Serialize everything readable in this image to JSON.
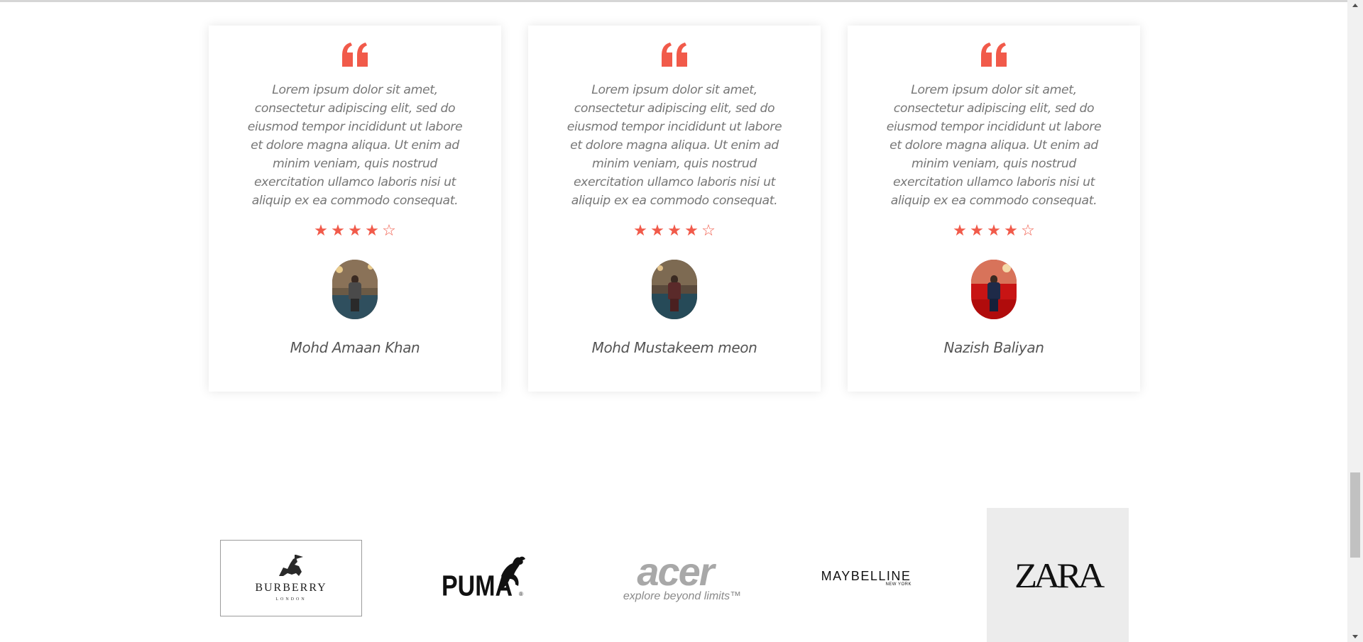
{
  "testimonials": [
    {
      "text": "Lorem ipsum dolor sit amet, consectetur adipiscing elit, sed do eiusmod tempor incididunt ut labore et dolore magna aliqua. Ut enim ad minim veniam, quis nostrud exercitation ullamco laboris nisi ut aliquip ex ea commodo consequat.",
      "rating": 4,
      "max_rating": 5,
      "name": "Mohd Amaan Khan"
    },
    {
      "text": "Lorem ipsum dolor sit amet, consectetur adipiscing elit, sed do eiusmod tempor incididunt ut labore et dolore magna aliqua. Ut enim ad minim veniam, quis nostrud exercitation ullamco laboris nisi ut aliquip ex ea commodo consequat.",
      "rating": 4,
      "max_rating": 5,
      "name": "Mohd Mustakeem meon"
    },
    {
      "text": "Lorem ipsum dolor sit amet, consectetur adipiscing elit, sed do eiusmod tempor incididunt ut labore et dolore magna aliqua. Ut enim ad minim veniam, quis nostrud exercitation ullamco laboris nisi ut aliquip ex ea commodo consequat.",
      "rating": 4,
      "max_rating": 5,
      "name": "Nazish Baliyan"
    }
  ],
  "brands": {
    "burberry": {
      "word": "BURBERRY",
      "sub": "LONDON"
    },
    "puma": {
      "word": "PUMA"
    },
    "acer": {
      "word": "acer",
      "tagline": "explore beyond limits™"
    },
    "maybelline": {
      "word": "MAYBELLINE",
      "sub": "NEW YORK"
    },
    "zara": {
      "word": "ZARA"
    }
  },
  "icons": {
    "quote": "quote-icon",
    "star_filled": "star-filled-icon",
    "star_empty": "star-empty-icon"
  },
  "colors": {
    "accent": "#f15a4a",
    "text_muted": "#777777",
    "name_text": "#555555"
  }
}
